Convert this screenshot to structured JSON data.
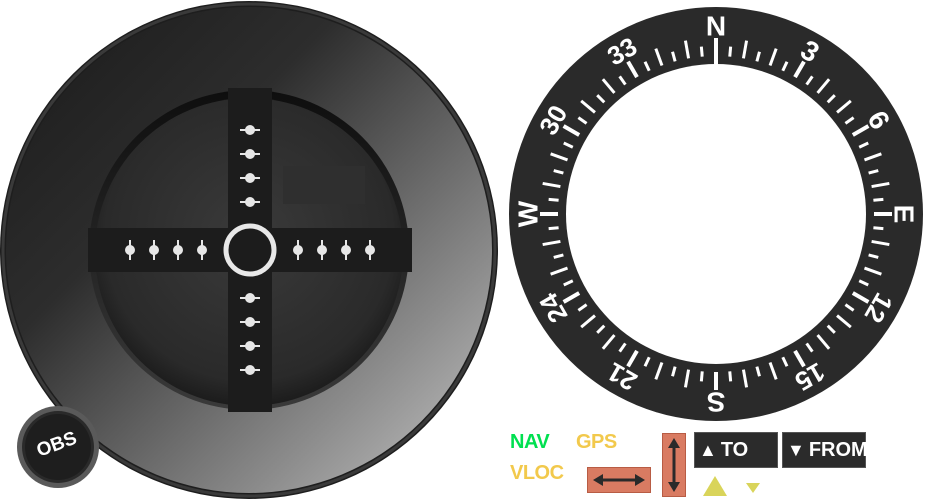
{
  "obs_knob": {
    "label": "OBS"
  },
  "compass_card": {
    "labels": [
      "N",
      "3",
      "6",
      "E",
      "12",
      "15",
      "S",
      "21",
      "24",
      "W",
      "30",
      "33"
    ]
  },
  "source_selector": {
    "nav": "NAV",
    "gps": "GPS",
    "vloc": "VLOC"
  },
  "to_from": {
    "to_label": "TO",
    "from_label": "FROM",
    "to_glyph": "▲",
    "from_glyph": "▼"
  },
  "colors": {
    "nav": "#00e050",
    "gps": "#f2c94c",
    "vloc": "#f2c94c",
    "arrow_box": "#d97b62",
    "indicator_triangle": "#d9d45a"
  }
}
